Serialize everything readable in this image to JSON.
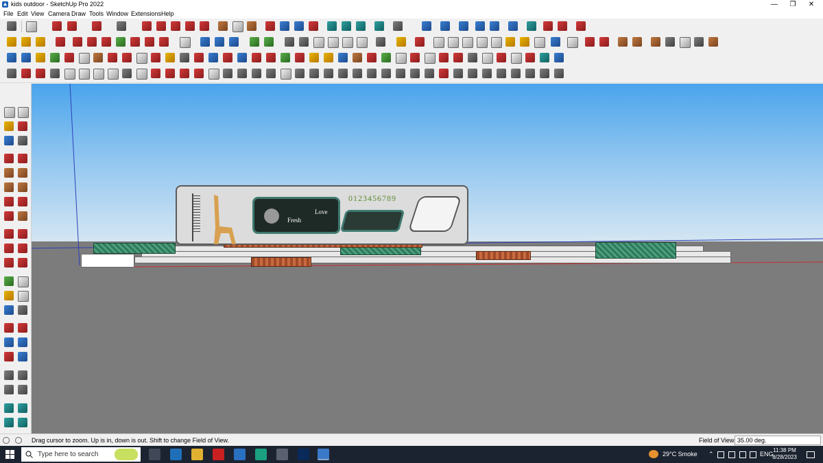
{
  "window": {
    "title": "kids outdoor - SketchUp Pro 2022",
    "controls": {
      "minimize": "—",
      "restore": "❐",
      "close": "✕"
    }
  },
  "menu": [
    "File",
    "Edit",
    "View",
    "Camera",
    "Draw",
    "Tools",
    "Window",
    "Extensions",
    "Help"
  ],
  "viewport": {
    "board_text_1": "Fresh",
    "board_text_2": "Love",
    "numbers": "0123456789"
  },
  "status": {
    "message": "Drag cursor to zoom.  Up is in, down is out. Shift to change Field of View.",
    "measure_label": "Field of View",
    "measure_value": "35.00 deg."
  },
  "taskbar": {
    "search_placeholder": "Type here to search",
    "weather": "29°C  Smoke",
    "language": "ENG",
    "time": "11:38 PM",
    "date": "8/28/2023"
  },
  "colors": {
    "sky_top": "#4aa4ec",
    "ground": "#7c7c7c",
    "taskbar": "#1c2330"
  }
}
